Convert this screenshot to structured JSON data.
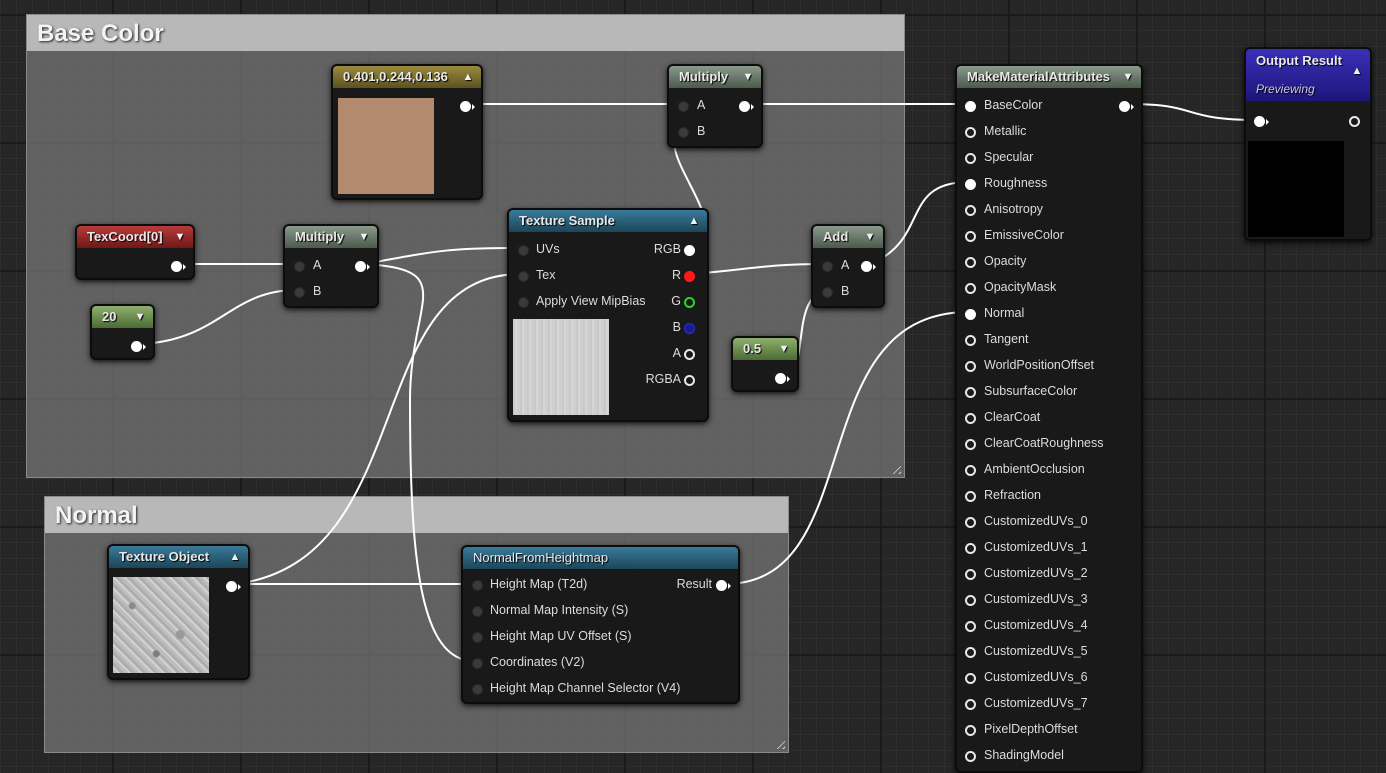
{
  "comments": {
    "base_color": "Base Color",
    "normal": "Normal"
  },
  "nodes": {
    "constant_color": {
      "title": "0.401,0.244,0.136",
      "swatch_color": "#b48a6e"
    },
    "multiply_top": {
      "title": "Multiply",
      "inputs": [
        "A",
        "B"
      ]
    },
    "texcoord": {
      "title": "TexCoord[0]"
    },
    "multiply_left": {
      "title": "Multiply",
      "inputs": [
        "A",
        "B"
      ]
    },
    "const_20": {
      "title": "20"
    },
    "texture_sample": {
      "title": "Texture Sample",
      "inputs": [
        "UVs",
        "Tex",
        "Apply View MipBias"
      ],
      "outputs": [
        "RGB",
        "R",
        "G",
        "B",
        "A",
        "RGBA"
      ]
    },
    "add": {
      "title": "Add",
      "inputs": [
        "A",
        "B"
      ]
    },
    "const_05": {
      "title": "0.5"
    },
    "texture_object": {
      "title": "Texture Object"
    },
    "normal_from_heightmap": {
      "title": "NormalFromHeightmap",
      "inputs": [
        "Height Map (T2d)",
        "Normal Map Intensity (S)",
        "Height Map UV Offset (S)",
        "Coordinates (V2)",
        "Height Map Channel Selector (V4)"
      ],
      "output": "Result"
    },
    "make_material_attributes": {
      "title": "MakeMaterialAttributes",
      "inputs": [
        "BaseColor",
        "Metallic",
        "Specular",
        "Roughness",
        "Anisotropy",
        "EmissiveColor",
        "Opacity",
        "OpacityMask",
        "Normal",
        "Tangent",
        "WorldPositionOffset",
        "SubsurfaceColor",
        "ClearCoat",
        "ClearCoatRoughness",
        "AmbientOcclusion",
        "Refraction",
        "CustomizedUVs_0",
        "CustomizedUVs_1",
        "CustomizedUVs_2",
        "CustomizedUVs_3",
        "CustomizedUVs_4",
        "CustomizedUVs_5",
        "CustomizedUVs_6",
        "CustomizedUVs_7",
        "PixelDepthOffset",
        "ShadingModel"
      ]
    },
    "output_result": {
      "title": "Output Result",
      "subtitle": "Previewing"
    }
  },
  "icons": {
    "collapse": "chevron-down-icon",
    "expand": "chevron-up-icon"
  },
  "colors": {
    "pin_red": "#ff1a1a",
    "pin_green": "#2ed12e",
    "pin_blue": "#1a1a99",
    "wire": "#ffffff"
  }
}
